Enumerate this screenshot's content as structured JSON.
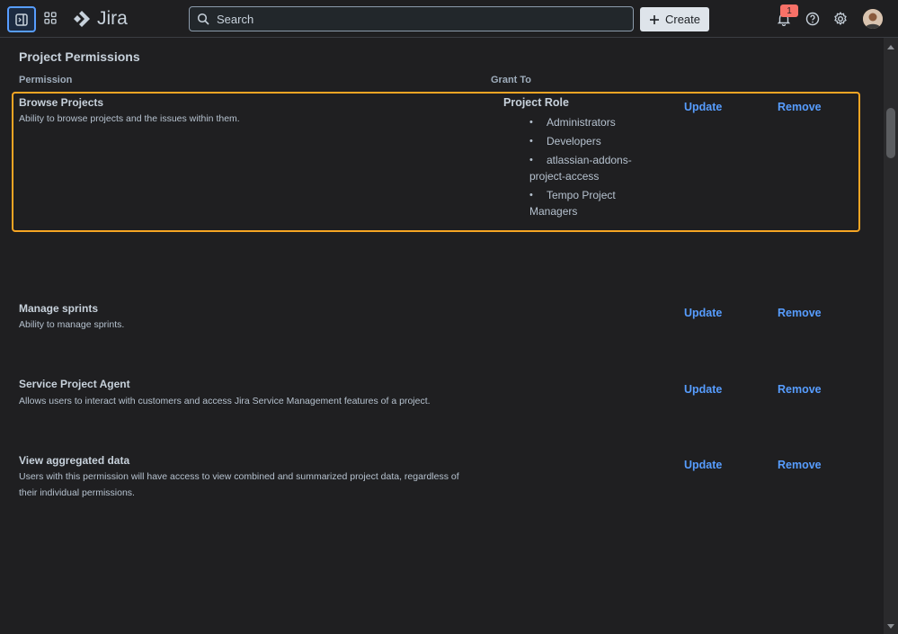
{
  "header": {
    "logo_text": "Jira",
    "search_placeholder": "Search",
    "create_label": "Create",
    "notification_count": "1",
    "icons": [
      "sidebar-toggle-icon",
      "apps-grid-icon",
      "jira-logo-icon",
      "search-icon",
      "plus-icon",
      "bell-icon",
      "help-icon",
      "gear-icon"
    ]
  },
  "page": {
    "title": "Project Permissions",
    "columns": {
      "permission": "Permission",
      "grant_to": "Grant To"
    }
  },
  "permissions": [
    {
      "name": "Browse Projects",
      "description": "Ability to browse projects and the issues within them.",
      "grant_type": "Project Role",
      "grants": [
        "Administrators",
        "Developers",
        "atlassian-addons-project-access",
        "Tempo Project Managers"
      ],
      "update_label": "Update",
      "remove_label": "Remove"
    },
    {
      "name": "Manage sprints",
      "description": "Ability to manage sprints.",
      "update_label": "Update",
      "remove_label": "Remove"
    },
    {
      "name": "Service Project Agent",
      "description": "Allows users to interact with customers and access Jira Service Management features of a project.",
      "update_label": "Update",
      "remove_label": "Remove"
    },
    {
      "name": "View aggregated data",
      "description": "Users with this permission will have access to view combined and summarized project data, regardless of their individual permissions.",
      "update_label": "Update",
      "remove_label": "Remove"
    }
  ],
  "colors": {
    "accent": "#579dff",
    "highlight": "#f5a524",
    "badge": "#f87168",
    "background": "#1f1f21"
  }
}
